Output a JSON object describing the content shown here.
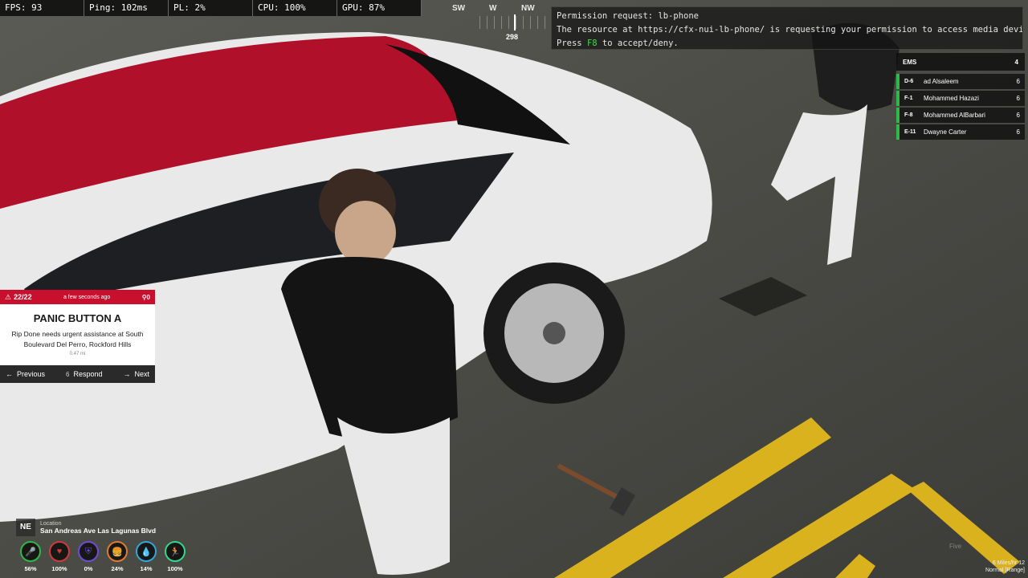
{
  "perf": [
    {
      "label": "FPS: 93"
    },
    {
      "label": "Ping: 102ms"
    },
    {
      "label": "PL: 2%"
    },
    {
      "label": "CPU: 100%"
    },
    {
      "label": "GPU: 87%"
    }
  ],
  "compass": {
    "dir_left": "SW",
    "dir_mid": "W",
    "dir_right": "NW",
    "heading": "298"
  },
  "permission": {
    "line1": "Permission request: lb-phone",
    "line2": "The resource at https://cfx-nui-lb-phone/ is requesting your permission to access media devices.",
    "line3_pre": "Press ",
    "line3_key": "F8",
    "line3_post": " to accept/deny."
  },
  "ems": {
    "title": "EMS",
    "count": "4",
    "members": [
      {
        "callsign": "D-6",
        "name": "ad Alsaleem",
        "num": "6"
      },
      {
        "callsign": "F-1",
        "name": "Mohammed Hazazi",
        "num": "6"
      },
      {
        "callsign": "F-8",
        "name": "Mohammed AlBarbari",
        "num": "6"
      },
      {
        "callsign": "E-11",
        "name": "Dwayne Carter",
        "num": "6"
      }
    ],
    "accent_color": "#2fb84a"
  },
  "alert": {
    "counter": "22/22",
    "time": "a few seconds ago",
    "marker": "0",
    "title": "PANIC BUTTON A",
    "description": "Rip Done needs urgent assistance at South Boulevard Del Perro, Rockford Hills",
    "distance": "0.47 mi",
    "prev_label": "Previous",
    "respond_key": "6",
    "respond_label": "Respond",
    "next_label": "Next",
    "accent_color": "#c8102e"
  },
  "location": {
    "direction": "NE",
    "label": "Location",
    "street": "San Andreas Ave Las Lagunas Blvd"
  },
  "status": [
    {
      "name": "voice-icon",
      "value": "56%",
      "color": "#2fb84a"
    },
    {
      "name": "health-icon",
      "value": "100%",
      "color": "#d23a3a"
    },
    {
      "name": "armor-icon",
      "value": "0%",
      "color": "#6f4bd8"
    },
    {
      "name": "hunger-icon",
      "value": "24%",
      "color": "#e07a2e"
    },
    {
      "name": "thirst-icon",
      "value": "14%",
      "color": "#2fa7d8"
    },
    {
      "name": "stamina-icon",
      "value": "100%",
      "color": "#2fd88a"
    }
  ],
  "bottom_right": {
    "line1": "6 Miles/hr 12",
    "line2": "Normal [Range]"
  },
  "watermark": "Five"
}
